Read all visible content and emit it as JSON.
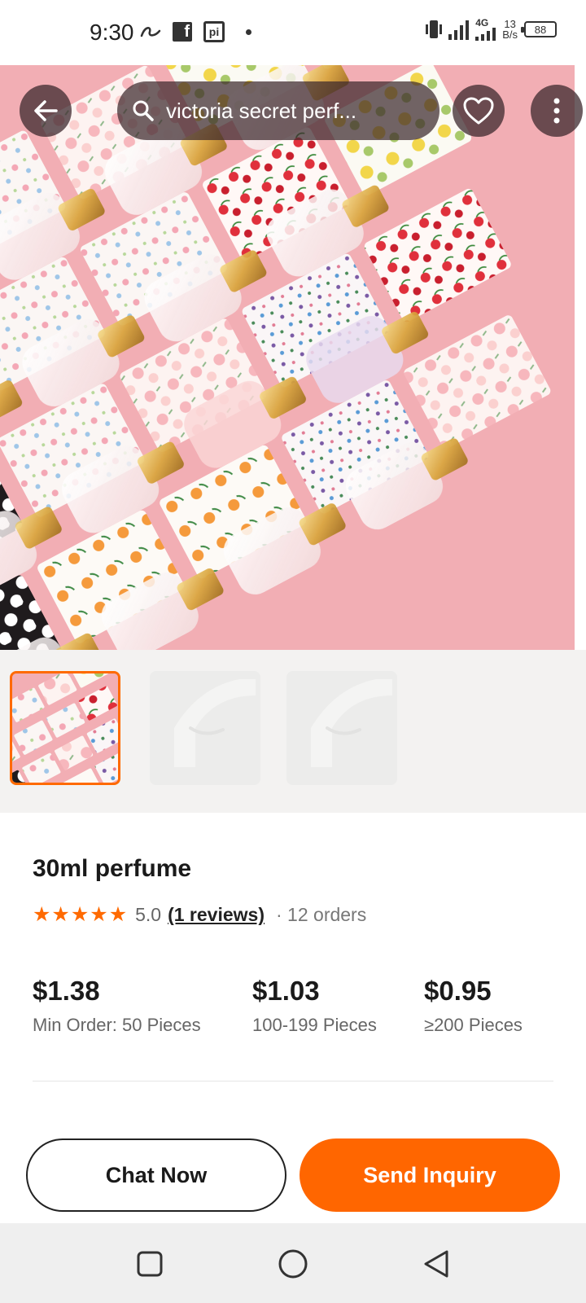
{
  "status_bar": {
    "time": "9:30",
    "network_type": "4G",
    "speed_value": "13",
    "speed_unit": "B/s",
    "battery": "88"
  },
  "header": {
    "search_query": "victoria secret perf...",
    "icons": {
      "back": "arrow-left-icon",
      "search": "search-icon",
      "favorite": "heart-icon",
      "more": "more-vertical-icon"
    }
  },
  "gallery": {
    "thumbnails": [
      {
        "state": "selected"
      },
      {
        "state": "placeholder"
      },
      {
        "state": "placeholder"
      }
    ]
  },
  "product": {
    "title": "30ml perfume",
    "rating": {
      "stars": 5,
      "value": "5.0",
      "reviews_label": "(1 reviews)",
      "orders_label": "· 12 orders"
    },
    "price_tiers": [
      {
        "price": "$1.38",
        "quantity": "Min Order: 50 Pieces"
      },
      {
        "price": "$1.03",
        "quantity": "100-199 Pieces"
      },
      {
        "price": "$0.95",
        "quantity": "≥200 Pieces"
      }
    ]
  },
  "actions": {
    "chat_label": "Chat Now",
    "inquiry_label": "Send Inquiry"
  },
  "colors": {
    "accent": "#ff6600",
    "star": "#ff6a00",
    "hero_background": "#f2aeb4"
  },
  "navigation": {
    "icons": [
      "recent-apps-icon",
      "home-icon",
      "back-icon"
    ]
  }
}
